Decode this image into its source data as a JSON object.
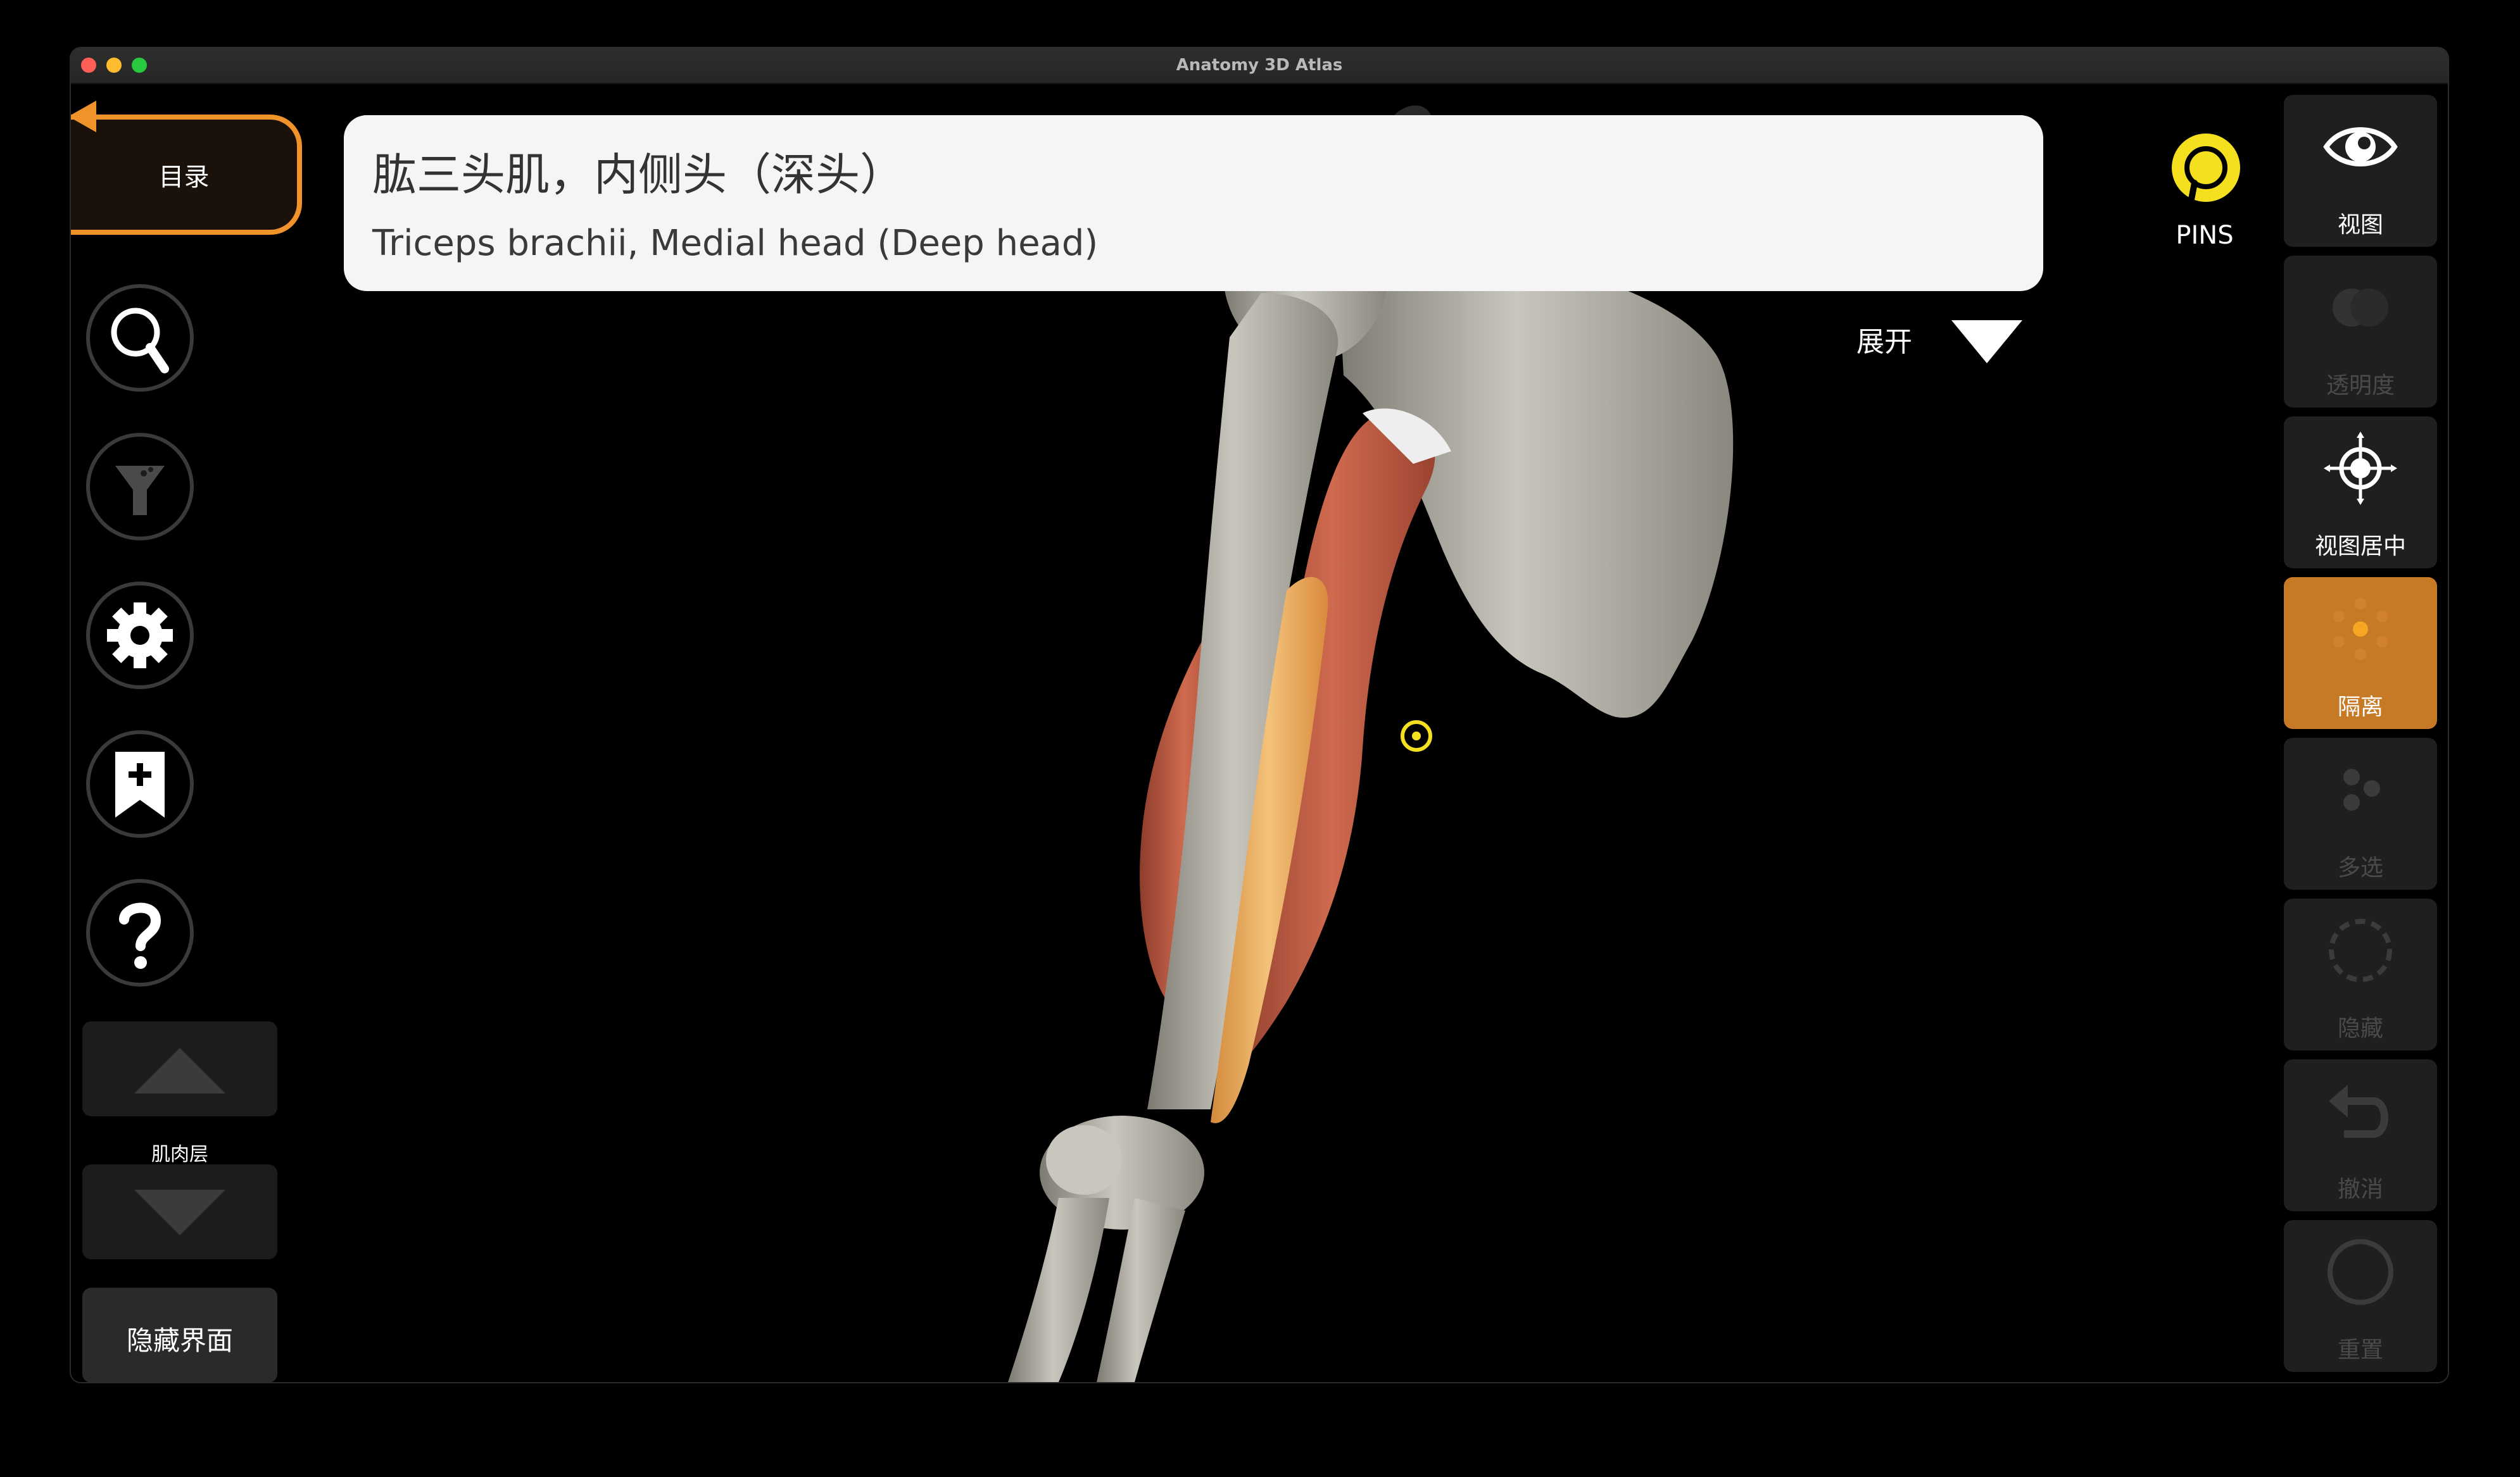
{
  "window": {
    "title": "Anatomy 3D Atlas"
  },
  "catalog": {
    "label": "目录"
  },
  "structure": {
    "name_zh": "肱三头肌，内侧头（深头）",
    "name_en": "Triceps brachii, Medial head (Deep head)"
  },
  "expand": {
    "label": "展开"
  },
  "pins": {
    "label": "PINS"
  },
  "left_toolbar": {
    "buttons": [
      {
        "icon": "search-icon"
      },
      {
        "icon": "filter-icon"
      },
      {
        "icon": "gear-icon"
      },
      {
        "icon": "bookmark-add-icon"
      },
      {
        "icon": "help-icon"
      }
    ],
    "layer_label": "肌肉层",
    "hide_ui_label": "隐藏界面"
  },
  "right_toolbar": {
    "items": [
      {
        "icon": "eye-icon",
        "label": "视图",
        "state": "enabled"
      },
      {
        "icon": "transparency-icon",
        "label": "透明度",
        "state": "disabled"
      },
      {
        "icon": "crosshair-icon",
        "label": "视图居中",
        "state": "enabled"
      },
      {
        "icon": "isolate-icon",
        "label": "隔离",
        "state": "active"
      },
      {
        "icon": "multiselect-icon",
        "label": "多选",
        "state": "disabled"
      },
      {
        "icon": "hide-icon",
        "label": "隐藏",
        "state": "disabled"
      },
      {
        "icon": "undo-icon",
        "label": "撤消",
        "state": "disabled"
      },
      {
        "icon": "reset-icon",
        "label": "重置",
        "state": "disabled"
      }
    ]
  },
  "colors": {
    "accent": "#f0932b",
    "active_tool": "#c77a25",
    "pin": "#f5e020",
    "muscle": "#c8644a",
    "bone": "#b9b6ad"
  }
}
